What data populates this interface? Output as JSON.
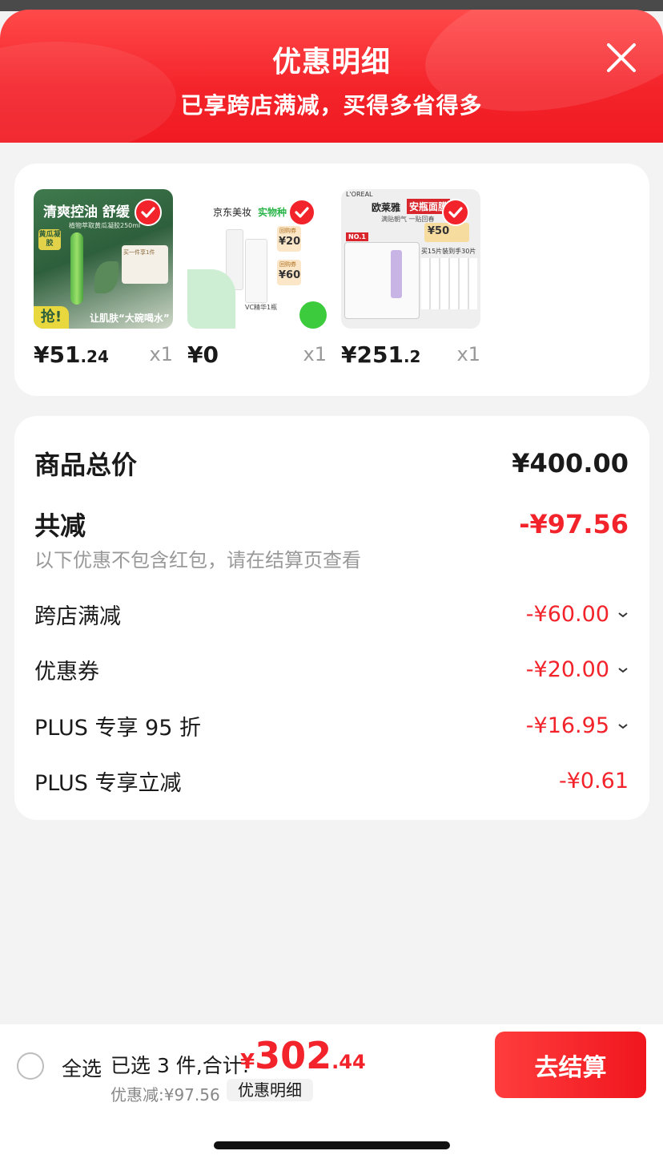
{
  "header": {
    "title": "优惠明细",
    "subtitle": "已享跨店满减，买得多省得多"
  },
  "products": [
    {
      "price_int": "¥51",
      "price_dec": ".24",
      "qty": "x1",
      "img_title": "清爽控油 舒缓",
      "img_badge": "黄瓜凝胶",
      "img_tag": "抢!",
      "img_slogan": "让肌肤“大碗喝水”",
      "img_side": "买一件享1件",
      "img_line": "植物萃取黄瓜凝胶250ml"
    },
    {
      "price_int": "¥0",
      "price_dec": "",
      "qty": "x1",
      "img_title": "京东美妆",
      "img_title2": "实物种",
      "coupon1": "¥20",
      "coupon2": "¥60",
      "coupon_label": "回购券",
      "img_caption": "VC精华1瓶"
    },
    {
      "price_int": "¥251",
      "price_dec": ".2",
      "qty": "x1",
      "img_brand": "L'OREAL",
      "img_title": "欧莱雅",
      "img_title2": "安瓶面膜",
      "img_sub": "满贴朝气 一贴回春",
      "coupon": "¥50",
      "img_promo": "买15片装到手30片",
      "img_no1": "NO.1"
    }
  ],
  "summary": {
    "total_label": "商品总价",
    "total_value": "¥400.00",
    "reduce_label": "共减",
    "reduce_value": "-¥97.56",
    "note": "以下优惠不包含红包，请在结算页查看",
    "items": [
      {
        "label": "跨店满减",
        "value": "-¥60.00"
      },
      {
        "label": "优惠券",
        "value": "-¥20.00"
      },
      {
        "label": "PLUS 专享 95 折",
        "value": "-¥16.95"
      },
      {
        "label": "PLUS 专享立减",
        "value": "-¥0.61"
      }
    ]
  },
  "bottom": {
    "select_all": "全选",
    "selected": "已选 3 件,合计:",
    "total_yen": "¥",
    "total_int": "302",
    "total_dec": ".44",
    "discount": "优惠减:¥97.56",
    "detail_tag": "优惠明细",
    "checkout": "去结算"
  },
  "colors": {
    "accent": "#f2232a",
    "header": "#f4232a"
  }
}
